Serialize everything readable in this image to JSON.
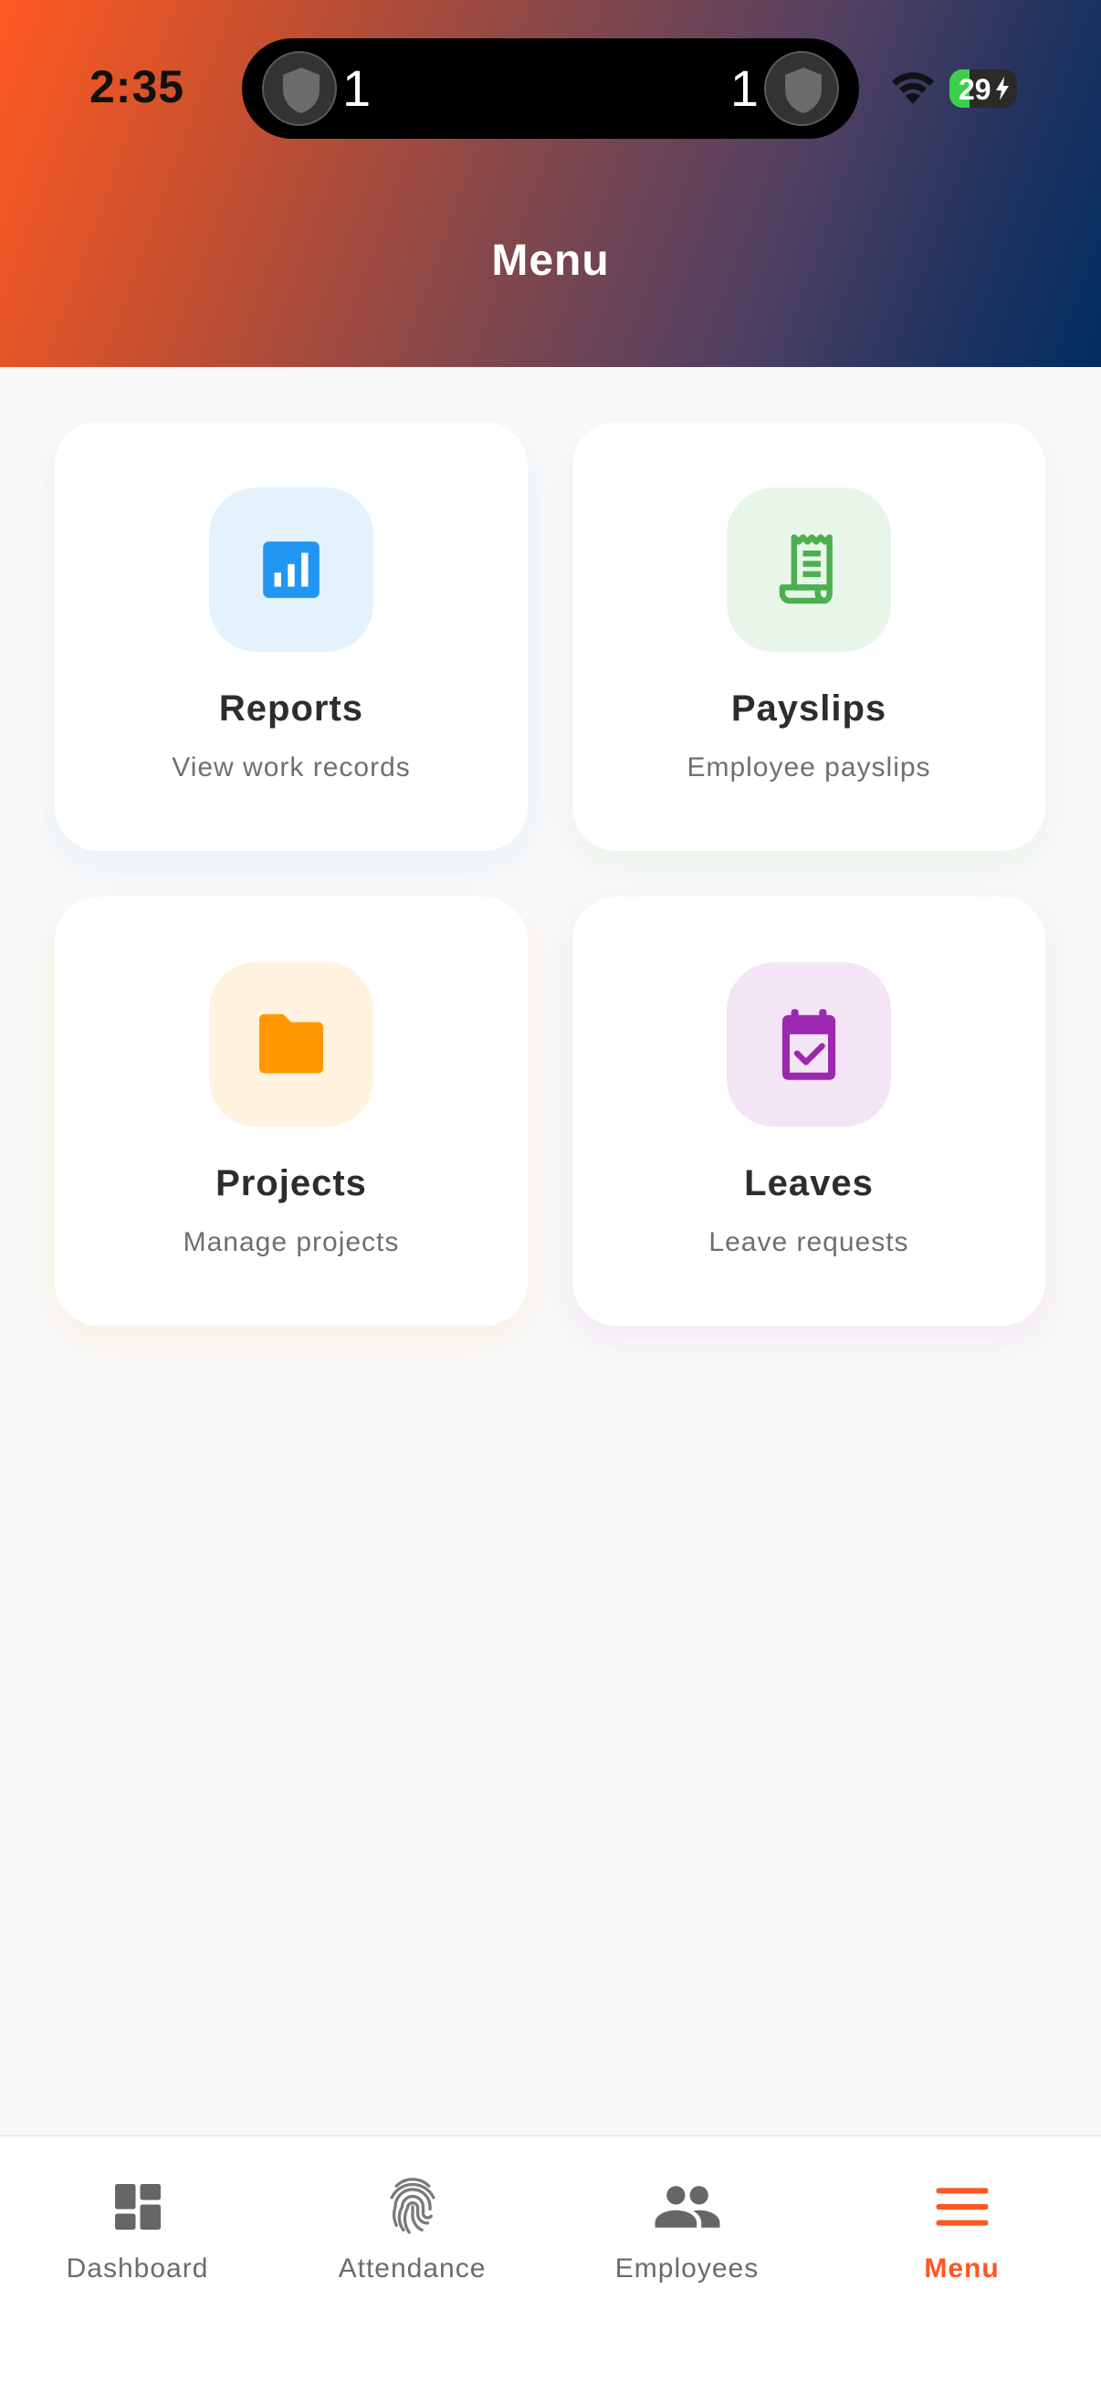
{
  "status_bar": {
    "time": "2:35",
    "island_left_count": "1",
    "island_right_count": "1",
    "battery": "29"
  },
  "header": {
    "title": "Menu"
  },
  "cards": [
    {
      "title": "Reports",
      "subtitle": "View work records",
      "icon": "bar-chart-icon",
      "color": "#2196F3",
      "bg": "#E3F2FD"
    },
    {
      "title": "Payslips",
      "subtitle": "Employee payslips",
      "icon": "receipt-icon",
      "color": "#4CAF50",
      "bg": "#E8F5E9"
    },
    {
      "title": "Projects",
      "subtitle": "Manage projects",
      "icon": "folder-icon",
      "color": "#FF9800",
      "bg": "#FFF3E0"
    },
    {
      "title": "Leaves",
      "subtitle": "Leave requests",
      "icon": "event-available-icon",
      "color": "#9C27B0",
      "bg": "#F3E5F5"
    }
  ],
  "bottom_nav": {
    "active": "Menu",
    "active_color": "#FF5722",
    "items": [
      {
        "label": "Dashboard",
        "icon": "dashboard-icon"
      },
      {
        "label": "Attendance",
        "icon": "fingerprint-icon"
      },
      {
        "label": "Employees",
        "icon": "people-icon"
      },
      {
        "label": "Menu",
        "icon": "menu-icon"
      }
    ]
  }
}
